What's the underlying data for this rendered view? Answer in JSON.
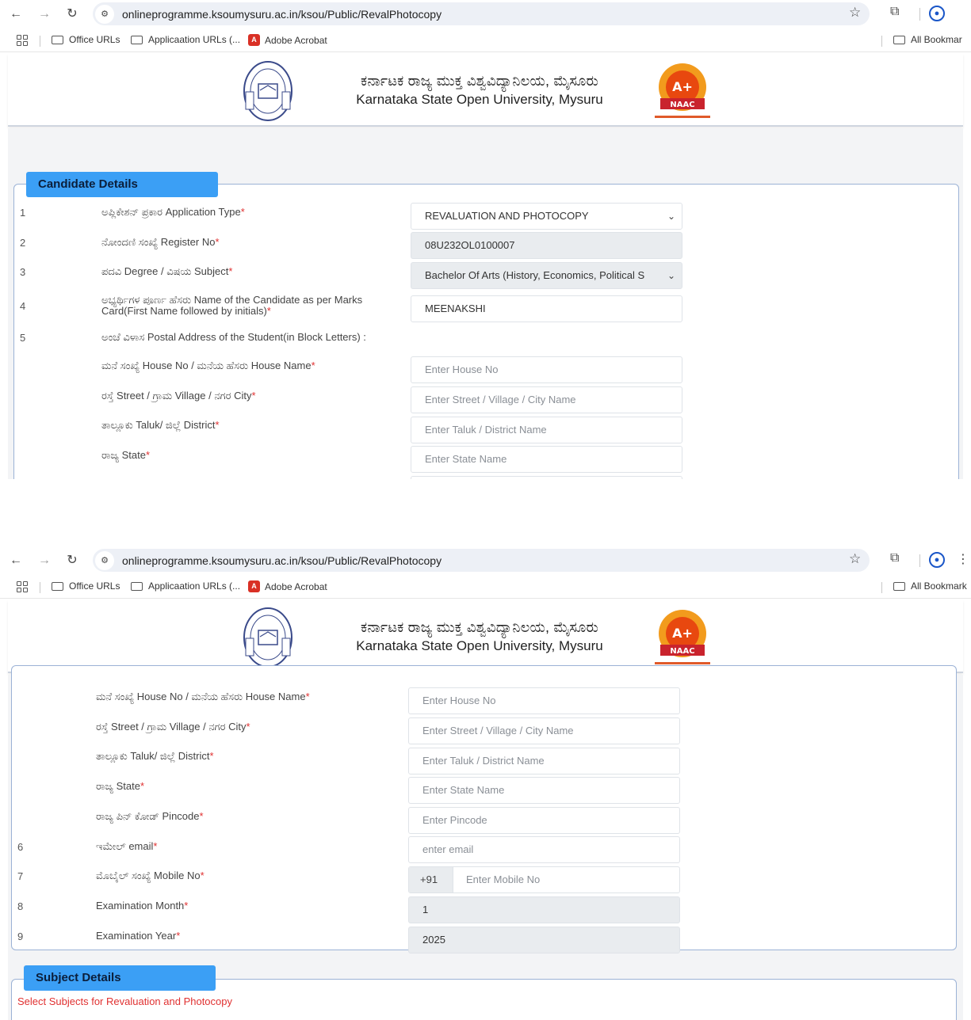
{
  "browser": {
    "url": "onlineprogramme.ksoumysuru.ac.in/ksou/Public/RevalPhotocopy",
    "bookmarks": [
      "Office URLs",
      "Applicaation URLs (...",
      "Adobe Acrobat"
    ],
    "all_bookmarks": "All Bookmar",
    "all_bookmarks_2": "All Bookmark"
  },
  "header": {
    "title_kn": "ಕರ್ನಾಟಕ ರಾಜ್ಯ ಮುಕ್ತ ವಿಶ್ವವಿದ್ಯಾನಿಲಯ, ಮೈಸೂರು",
    "title_en": "Karnataka State Open University, Mysuru",
    "naac_grade": "A+",
    "naac_label": "NAAC"
  },
  "candidate": {
    "legend": "Candidate Details",
    "rows": [
      {
        "num": "1",
        "label": "ಅಪ್ಲಿಕೇಶನ್ ಪ್ರಕಾರ Application Type",
        "value": "REVALUATION AND PHOTOCOPY"
      },
      {
        "num": "2",
        "label": "ನೋಂದಣಿ ಸಂಖ್ಯೆ Register No",
        "value": "08U232OL0100007"
      },
      {
        "num": "3",
        "label": "ಪದವಿ Degree / ವಿಷಯ Subject",
        "value": "Bachelor Of Arts (History, Economics, Political S"
      },
      {
        "num": "4",
        "label": "ಅಭ್ಯರ್ಥಿಗಳ ಪೂರ್ಣ ಹೆಸರು Name of the Candidate as per Marks",
        "label2": "Card(First Name followed by initials)",
        "value": "MEENAKSHI"
      },
      {
        "num": "5",
        "label": "ಅಂಚೆ ವಿಳಾಸ Postal Address of the Student(in Block Letters) :"
      }
    ],
    "address": [
      {
        "label": "ಮನೆ ಸಂಖ್ಯೆ House No / ಮನೆಯ ಹೆಸರು House Name",
        "placeholder": "Enter House No"
      },
      {
        "label": "ರಸ್ತೆ Street / ಗ್ರಾಮ Village / ನಗರ City",
        "placeholder": "Enter Street / Village / City Name"
      },
      {
        "label": "ತಾಲ್ಲೂಕು Taluk/ ಜಿಲ್ಲೆ District",
        "placeholder": "Enter Taluk / District Name"
      },
      {
        "label": "ರಾಜ್ಯ State",
        "placeholder": "Enter State Name"
      },
      {
        "label": "ರಾಜ್ಯ ಪಿನ್ ಕೋಡ್ Pincode",
        "placeholder": "Enter Pincode"
      }
    ],
    "more": [
      {
        "num": "6",
        "label": "ಇಮೇಲ್ email",
        "placeholder": "enter email"
      },
      {
        "num": "7",
        "label": "ಮೊಬೈಲ್ ಸಂಖ್ಯೆ Mobile No",
        "prefix": "+91",
        "placeholder": "Enter Mobile No"
      },
      {
        "num": "8",
        "label": "Examination Month",
        "value": "1"
      },
      {
        "num": "9",
        "label": "Examination Year",
        "value": "2025"
      }
    ]
  },
  "subjects": {
    "legend": "Subject Details",
    "note": "Select Subjects for Revaluation and Photocopy"
  },
  "colors": {
    "legend_bg": "#3b9ff5",
    "required": "#e03131",
    "panel_border": "#9bb2d6"
  }
}
